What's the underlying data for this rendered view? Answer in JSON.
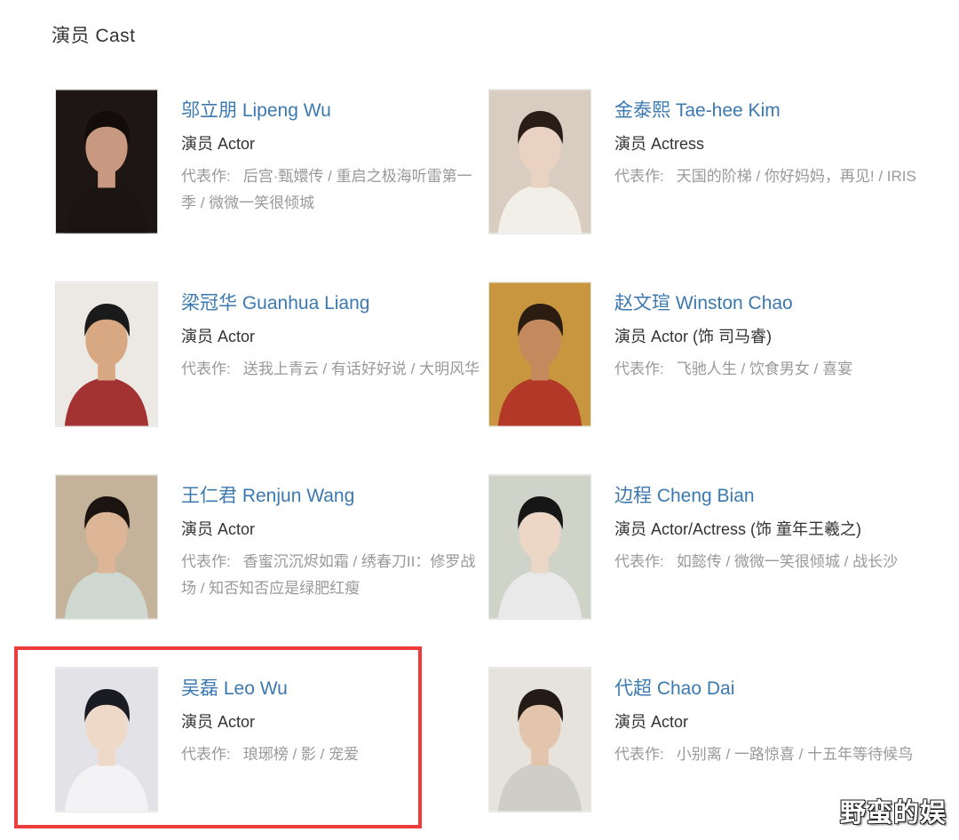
{
  "section_title": "演员 Cast",
  "cast": [
    {
      "name": "邬立朋 Lipeng Wu",
      "role": "演员 Actor",
      "works_label": "代表作:",
      "works": "后宫·甄嬛传 / 重启之极海听雷第一季 / 微微一笑很倾城",
      "photo_colors": {
        "bg": "#1e1614",
        "skin": "#c89880",
        "hair": "#120c0a",
        "cloth": "#1a1412"
      }
    },
    {
      "name": "金泰熙 Tae-hee Kim",
      "role": "演员 Actress",
      "works_label": "代表作:",
      "works": "天国的阶梯 / 你好妈妈，再见! / IRIS",
      "photo_colors": {
        "bg": "#d9cdc2",
        "skin": "#ead2c2",
        "hair": "#2a1c16",
        "cloth": "#f2efe9"
      }
    },
    {
      "name": "梁冠华 Guanhua Liang",
      "role": "演员 Actor",
      "works_label": "代表作:",
      "works": "送我上青云 / 有话好好说 / 大明风华",
      "photo_colors": {
        "bg": "#ece8e4",
        "skin": "#d8a882",
        "hair": "#1a1a1a",
        "cloth": "#a33232"
      }
    },
    {
      "name": "赵文瑄 Winston Chao",
      "role": "演员 Actor (饰 司马睿)",
      "works_label": "代表作:",
      "works": "飞驰人生 / 饮食男女 / 喜宴",
      "photo_colors": {
        "bg": "#c7963e",
        "skin": "#c4895c",
        "hair": "#2b1c12",
        "cloth": "#b33828"
      }
    },
    {
      "name": "王仁君 Renjun Wang",
      "role": "演员 Actor",
      "works_label": "代表作:",
      "works": "香蜜沉沉烬如霜 / 绣春刀II：修罗战场 / 知否知否应是绿肥红瘦",
      "photo_colors": {
        "bg": "#c4b39a",
        "skin": "#dcb496",
        "hair": "#1c1410",
        "cloth": "#cfd8d0"
      }
    },
    {
      "name": "边程 Cheng Bian",
      "role": "演员 Actor/Actress (饰 童年王羲之)",
      "works_label": "代表作:",
      "works": "如懿传 / 微微一笑很倾城 / 战长沙",
      "photo_colors": {
        "bg": "#cfd3c8",
        "skin": "#ecd6c6",
        "hair": "#161616",
        "cloth": "#e9e9e9"
      }
    },
    {
      "name": "吴磊 Leo Wu",
      "role": "演员 Actor",
      "works_label": "代表作:",
      "works": "琅琊榜 / 影 / 宠爱",
      "photo_colors": {
        "bg": "#e3e2e7",
        "skin": "#eed8c8",
        "hair": "#1b1b24",
        "cloth": "#f3f3f5"
      }
    },
    {
      "name": "代超 Chao Dai",
      "role": "演员 Actor",
      "works_label": "代表作:",
      "works": "小别离 / 一路惊喜 / 十五年等待候鸟",
      "photo_colors": {
        "bg": "#e6e3dd",
        "skin": "#e3c4ac",
        "hair": "#241a16",
        "cloth": "#cfcdc8"
      }
    }
  ],
  "highlight_color": "#ee3b3b",
  "watermark": "野蛮的娱"
}
